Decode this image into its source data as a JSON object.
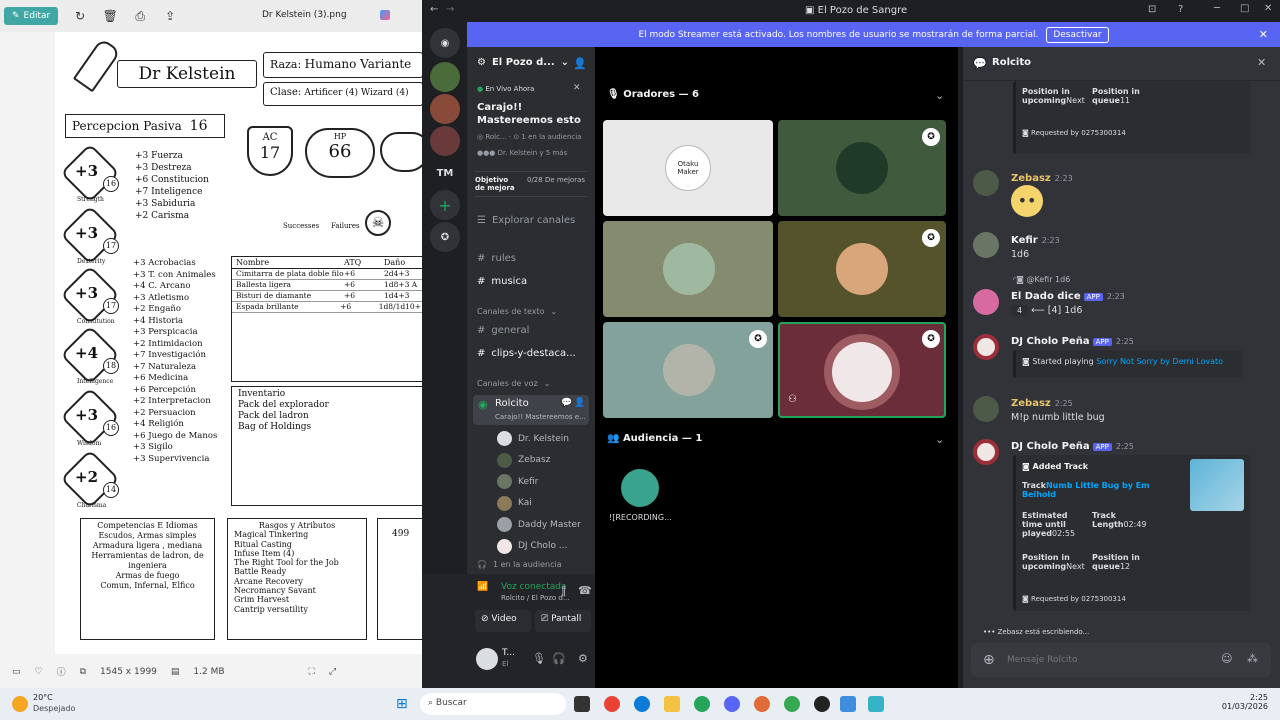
{
  "viewer": {
    "edit_label": "Editar",
    "file_name": "Dr Kelstein (3).png",
    "status": {
      "dimensions": "1545 x 1999",
      "size": "1.2 MB"
    },
    "sheet": {
      "name": "Dr Kelstein",
      "race_label": "Raza:",
      "race": "Humano Variante",
      "class_label": "Clase:",
      "class": "Artificer (4) Wizard (4)",
      "passive_label": "Percepcion Pasiva",
      "passive": "16",
      "ac_label": "AC",
      "ac": "17",
      "hp_label": "HP",
      "hp": "66",
      "successes": "Successes",
      "failures": "Failures",
      "abilities": [
        {
          "mod": "+3",
          "score": "16",
          "name": "Strength"
        },
        {
          "mod": "+3",
          "score": "17",
          "name": "Dexterity"
        },
        {
          "mod": "+3",
          "score": "17",
          "name": "Constitution"
        },
        {
          "mod": "+4",
          "score": "18",
          "name": "Intelligence"
        },
        {
          "mod": "+3",
          "score": "16",
          "name": "Wisdom"
        },
        {
          "mod": "+2",
          "score": "14",
          "name": "Charisma"
        }
      ],
      "saves": [
        "+3 Fuerza",
        "+3 Destreza",
        "+6 Constitucion",
        "+7 Inteligence",
        "+3 Sabiduria",
        "+2 Carisma"
      ],
      "skills": [
        "+3 Acrobacias",
        "+3 T. con Animales",
        "+4 C. Arcano",
        "+3 Atletismo",
        "+2 Engaño",
        "+4 Historia",
        "+3 Perspicacia",
        "+2 Intimidacion",
        "+7 Investigación",
        "+7 Naturaleza",
        "+6 Medicina",
        "+6 Percepción",
        "+2 Interpretacion",
        "+2 Persuacion",
        "+4 Religión",
        "+6 Juego de Manos",
        "+3 Sigilo",
        "+3 Supervivencia"
      ],
      "weapons_header": [
        "Nombre",
        "ATQ",
        "Daño"
      ],
      "weapons": [
        [
          "Cimitarra de plata doble filo",
          "+6",
          "2d4+3"
        ],
        [
          "Ballesta ligera",
          "+6",
          "1d8+3 A"
        ],
        [
          "Bisturi de diamante",
          "+6",
          "1d4+3"
        ],
        [
          "Espada brillante",
          "+6",
          "1d8/1d10+"
        ]
      ],
      "inventory_title": "Inventario",
      "inventory": [
        "Pack del explorador",
        "Pack del ladron",
        "Bag of Holdings"
      ],
      "prof_title": "Competencias E Idiomas",
      "prof": [
        "Escudos, Armas simples",
        "Armadura ligera , mediana",
        "Herramientas de ladron, de ingeniera",
        "Armas de fuego",
        "Comun, Infernal, Elfico"
      ],
      "traits_title": "Rasgos y Atributos",
      "traits": [
        "Magical Tinkering",
        "Ritual Casting",
        "Infuse Item (4)",
        "The Right Tool for the Job",
        "Battle Ready",
        "Arcane Recovery",
        "Necromancy Savant",
        "Grim Harvest",
        "Cantrip versatility"
      ],
      "extra": "499"
    }
  },
  "discord": {
    "window_title": "El Pozo de Sangre",
    "streamer_text": "El modo Streamer está activado. Los nombres de usuario se mostrarán de forma parcial.",
    "deactivate": "Desactivar",
    "server_initials": "TM",
    "server_name": "El Pozo d...",
    "live_badge": "En Vivo Ahora",
    "stage_title": "Carajo!! Mastereemos esto",
    "stage_meta": "Rolc...",
    "audience_meta": "1 en la audiencia",
    "speakers_meta": "Dr. Kelstein y 5 más",
    "boost_label": "Objetivo de mejora",
    "boost_value": "0/28 De mejoras",
    "explore": "Explorar canales",
    "channels_top": [
      "rules",
      "musica"
    ],
    "text_category": "Canales de texto",
    "text_channels": [
      "general",
      "clips-y-destaca..."
    ],
    "voice_category": "Canales de voz",
    "voice_channel": "Rolcito",
    "voice_sub": "Carajo!! Mastereemos e...",
    "voice_users": [
      "Dr. Kelstein",
      "Zebasz",
      "Kefir",
      "Kai",
      "Daddy Master",
      "DJ Cholo ..."
    ],
    "voice_audience": "1 en la audiencia",
    "voice_connected": "Voz conectada",
    "voice_location": "Rolcito / El Pozo d...",
    "video_btn": "Video",
    "screen_btn": "Pantall",
    "user_name": "T...",
    "user_status": "El",
    "speakers_header": "Oradores — 6",
    "audience_header": "Audiencia — 1",
    "tile1_text": "Otaku Maker",
    "audience_member": "![RECORDING...",
    "chat_title": "Rolcito",
    "typing": "Zebasz está escribiendo...",
    "input_placeholder": "Mensaje Rolcito",
    "messages": {
      "top_embed": {
        "f1": "Position in upcoming",
        "f1v": "Next",
        "f2": "Position in queue",
        "f2v": "11",
        "req": "Requested by 0275300314"
      },
      "zebasz1": {
        "name": "Zebasz",
        "time": "2:23"
      },
      "kefir": {
        "name": "Kefir",
        "time": "2:23",
        "text": "1d6"
      },
      "reply": "@Kefir 1d6",
      "dado": {
        "name": "El Dado dice",
        "app": "APP",
        "time": "2:23",
        "roll": "4",
        "text": "⟵ [4] 1d6"
      },
      "cholo1": {
        "name": "DJ Cholo Peña",
        "app": "APP",
        "time": "2:25",
        "pre": "Started playing ",
        "song": "Sorry Not Sorry by Demi Lovato"
      },
      "zebasz2": {
        "name": "Zebasz",
        "time": "2:25",
        "text": "M!p numb little bug"
      },
      "cholo2": {
        "name": "DJ Cholo Peña",
        "app": "APP",
        "time": "2:25",
        "added": "Added Track",
        "track_label": "Track",
        "track": "Numb Little Bug by Em Beihold",
        "est_label": "Estimated time until played",
        "est": "02:55",
        "len_label": "Track Length",
        "len": "02:49",
        "pos_up": "Position in upcoming",
        "pos_up_v": "Next",
        "pos_q": "Position in queue",
        "pos_q_v": "12",
        "req": "Requested by 0275300314"
      }
    }
  },
  "taskbar": {
    "weather_temp": "20°C",
    "weather_desc": "Despejado",
    "search": "Buscar",
    "time": "2:25",
    "date": "01/03/2026"
  }
}
